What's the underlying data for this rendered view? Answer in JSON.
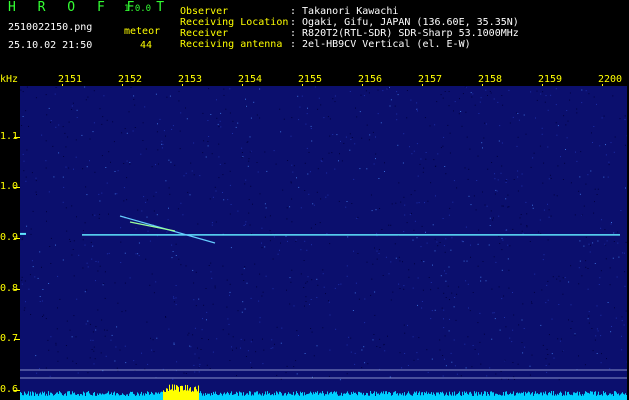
{
  "header": {
    "brand": "H R O F F T",
    "version": "1.0.0",
    "filename": "2510022150.png",
    "meteor_label": "meteor",
    "datetime": "25.10.02 21:50",
    "meteor_count": "44",
    "info": [
      {
        "label": "Observer",
        "value": ": Takanori Kawachi"
      },
      {
        "label": "Receiving Location",
        "value": ": Ogaki, Gifu, JAPAN (136.60E, 35.35N)"
      },
      {
        "label": "Receiver",
        "value": ": R820T2(RTL-SDR) SDR-Sharp 53.1000MHz"
      },
      {
        "label": "Receiving antenna",
        "value": ": 2el-HB9CV Vertical (el. E-W)"
      }
    ]
  },
  "chart_data": {
    "type": "heatmap",
    "ylabel": "kHz",
    "x_ticks": [
      "2151",
      "2152",
      "2153",
      "2154",
      "2155",
      "2156",
      "2157",
      "2158",
      "2159",
      "2200"
    ],
    "y_ticks": [
      "1.1",
      "1.0",
      "0.9",
      "0.8",
      "0.7",
      "0.6"
    ],
    "ylim": [
      0.58,
      1.2
    ],
    "carrier_khz": 0.906,
    "colors": {
      "background": "#0b0f6e",
      "signal": "#5fe6ff",
      "axis": "#ffff00",
      "bar": "#00cfff",
      "burst": "#ffff00"
    }
  }
}
